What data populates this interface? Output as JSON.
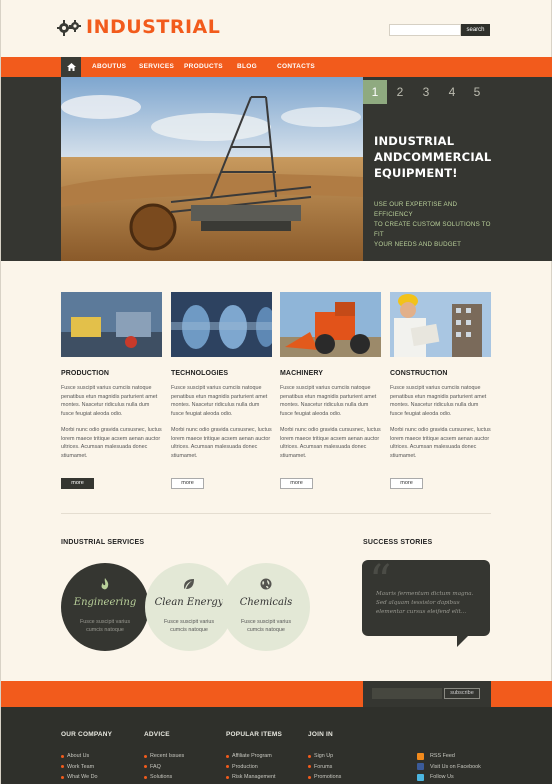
{
  "header": {
    "logo_text": "INDUSTRIAL",
    "search_button": "search"
  },
  "nav": {
    "home_icon": "home-icon",
    "items": [
      "ABOUTUS",
      "SERVICES",
      "PRODUCTS",
      "BLOG",
      "CONTACTS"
    ]
  },
  "hero": {
    "slides": [
      "1",
      "2",
      "3",
      "4",
      "5"
    ],
    "active_slide": "1",
    "title_line1": "INDUSTRIAL",
    "title_line2": "ANDCOMMERCIAL",
    "title_line3": "EQUIPMENT!",
    "subtitle_line1": "USE OUR EXPERTISE AND EFFICIENCY",
    "subtitle_line2": "TO CREATE CUSTOM SOLUTIONS TO FIT",
    "subtitle_line3": "YOUR NEEDS AND BUDGET"
  },
  "features": [
    {
      "title": "PRODUCTION",
      "text1": "Fusce suscipit varius cumciis natoque penatibus etun magnidis parturient  amet montes. Nascetur ridiculus nulla dum fusce feugiat aleoda odio.",
      "text2": "Morbi nunc odio gravida cursusnec, luctus lorem maece tritique acsem aenan auctor ultrices. Acumsan malesuada donec stiumamet.",
      "more": "more"
    },
    {
      "title": "TECHNOLOGIES",
      "text1": "Fusce suscipit varius cumciis natoque penatibus etun magnidis parturient  amet montes. Nascetur ridiculus nulla dum fusce feugiat aleoda odio.",
      "text2": "Morbi nunc odio gravida cursusnec, luctus lorem maece tritique acsem aenan auctor ultrices. Acumsan malesuada donec stiumamet.",
      "more": "more"
    },
    {
      "title": "MACHINERY",
      "text1": "Fusce suscipit varius cumciis natoque penatibus etun magnidis parturient  amet montes. Nascetur ridiculus nulla dum fusce feugiat aleoda odio.",
      "text2": "Morbi nunc odio gravida cursusnec, luctus lorem maece tritique acsem aenan auctor ultrices. Acumsan malesuada donec stiumamet.",
      "more": "more"
    },
    {
      "title": "CONSTRUCTION",
      "text1": "Fusce suscipit varius cumciis natoque penatibus etun magnidis parturient  amet montes. Nascetur ridiculus nulla dum fusce feugiat aleoda odio.",
      "text2": "Morbi nunc odio gravida cursusnec, luctus lorem maece tritique acsem aenan auctor ultrices. Acumsan malesuada donec stiumamet.",
      "more": "more"
    }
  ],
  "services": {
    "title": "INDUSTRIAL SERVICES",
    "items": [
      {
        "label": "Engineering",
        "text": "Fusce suscipit varius cumcis natoque",
        "icon": "fire-icon"
      },
      {
        "label": "Clean Energy",
        "text": "Fusce suscipit varius cumcis natoque",
        "icon": "leaf-icon"
      },
      {
        "label": "Chemicals",
        "text": "Fusce suscipit varius cumcis natoque",
        "icon": "globe-icon"
      }
    ]
  },
  "stories": {
    "title": "SUCCESS STORIES",
    "quote": "Mauris fermentum dictum magna. Sed alquam tessistor dapibus elementar cursus eleifend elit..."
  },
  "subscribe": {
    "button": "subscribe"
  },
  "footer": {
    "columns": [
      {
        "heading": "OUR COMPANY",
        "links": [
          "About Us",
          "Work Team",
          "What We Do"
        ]
      },
      {
        "heading": "ADVICE",
        "links": [
          "Recent Issues",
          "FAQ",
          "Solutions"
        ]
      },
      {
        "heading": "POPULAR ITEMS",
        "links": [
          "Affiliate Program",
          "Production",
          "Risk Management"
        ]
      },
      {
        "heading": "JOIN IN",
        "links": [
          "Sign Up",
          "Forums",
          "Promotions"
        ]
      }
    ],
    "social": [
      {
        "label": "RSS Feed",
        "color": "#f28a1c",
        "icon": "rss-icon"
      },
      {
        "label": "Visit Us on Facebook",
        "color": "#3b5b9a",
        "icon": "facebook-icon"
      },
      {
        "label": "Follow Us",
        "color": "#4cb6e0",
        "icon": "twitter-icon"
      }
    ]
  },
  "colors": {
    "accent": "#f25b1c",
    "dark": "#353631",
    "green": "#8faa80"
  }
}
